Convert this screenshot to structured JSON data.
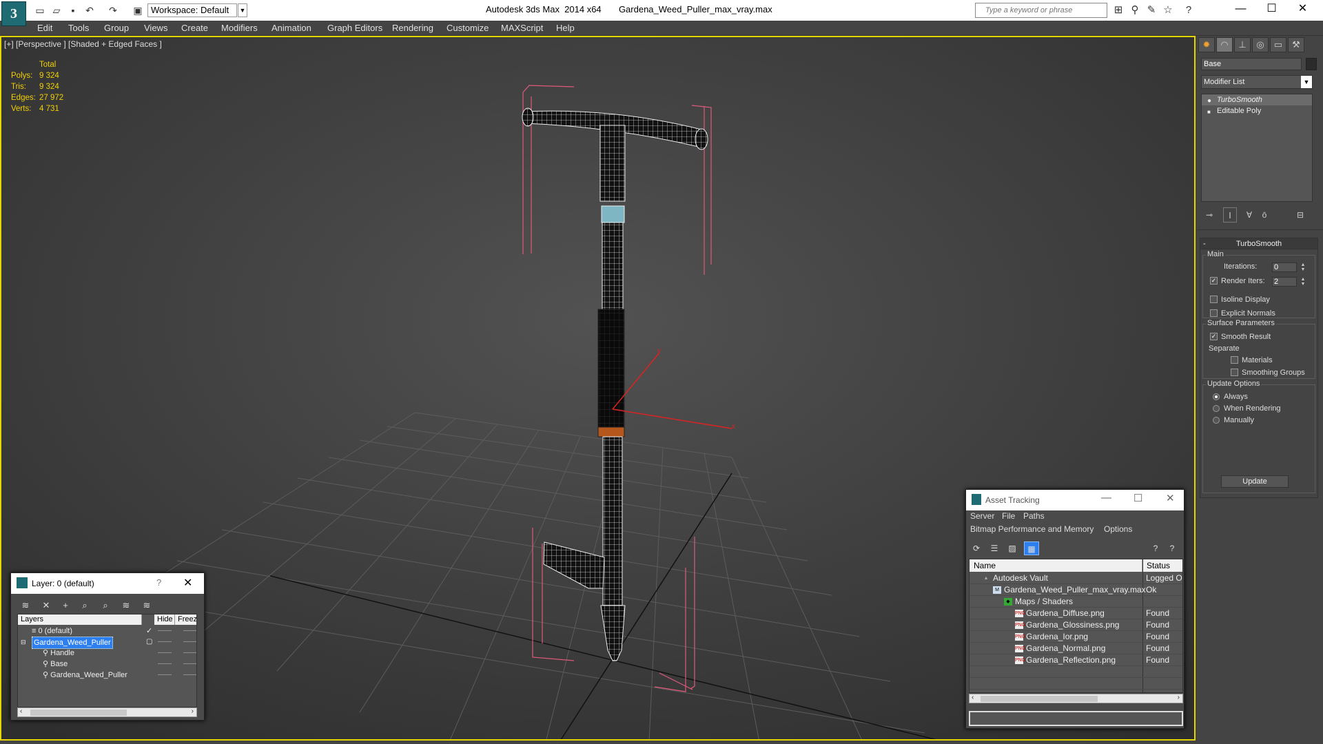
{
  "app": {
    "logo_letter": "3",
    "workspace": "Workspace: Default",
    "title": "Autodesk 3ds Max  2014 x64       Gardena_Weed_Puller_max_vray.max",
    "search_placeholder": "Type a keyword or phrase"
  },
  "menu": [
    "Edit",
    "Tools",
    "Group",
    "Views",
    "Create",
    "Modifiers",
    "Animation",
    "Graph Editors",
    "Rendering",
    "Customize",
    "MAXScript",
    "Help"
  ],
  "viewport": {
    "label": "[+] [Perspective ] [Shaded + Edged Faces ]",
    "stats_header": "Total",
    "stats": [
      {
        "k": "Polys:",
        "v": "9 324"
      },
      {
        "k": "Tris:",
        "v": "9 324"
      },
      {
        "k": "Edges:",
        "v": "27 972"
      },
      {
        "k": "Verts:",
        "v": "4 731"
      }
    ],
    "axis": {
      "x": "x",
      "y": "y"
    }
  },
  "command_panel": {
    "object_name": "Base",
    "modifier_list": "Modifier List",
    "stack": [
      "TurboSmooth",
      "Editable Poly"
    ],
    "rollout_title": "TurboSmooth",
    "main_label": "Main",
    "iterations_label": "Iterations:",
    "iterations_value": "0",
    "render_iters_label": "Render Iters:",
    "render_iters_value": "2",
    "isoline": "Isoline Display",
    "explicit": "Explicit Normals",
    "surface_label": "Surface Parameters",
    "smooth_result": "Smooth Result",
    "separate_label": "Separate",
    "materials": "Materials",
    "smoothing_groups": "Smoothing Groups",
    "update_label": "Update Options",
    "always": "Always",
    "when_rendering": "When Rendering",
    "manually": "Manually",
    "update_button": "Update"
  },
  "layer_dialog": {
    "title": "Layer: 0 (default)",
    "help": "?",
    "col_layers": "Layers",
    "col_hide": "Hide",
    "col_freeze": "Freez",
    "rows": [
      "0 (default)",
      "Gardena_Weed_Puller",
      "Handle",
      "Base",
      "Gardena_Weed_Puller"
    ]
  },
  "asset_tracking": {
    "title": "Asset Tracking",
    "menu_server": "Server",
    "menu_file": "File",
    "menu_paths": "Paths",
    "menu_bitmap": "Bitmap Performance and Memory",
    "menu_options": "Options",
    "col_name": "Name",
    "col_status": "Status",
    "rows": [
      {
        "name": "Autodesk Vault",
        "status": "Logged O"
      },
      {
        "name": "Gardena_Weed_Puller_max_vray.max",
        "status": "Ok"
      },
      {
        "name": "Maps / Shaders",
        "status": ""
      },
      {
        "name": "Gardena_Diffuse.png",
        "status": "Found"
      },
      {
        "name": "Gardena_Glossiness.png",
        "status": "Found"
      },
      {
        "name": "Gardena_Ior.png",
        "status": "Found"
      },
      {
        "name": "Gardena_Normal.png",
        "status": "Found"
      },
      {
        "name": "Gardena_Reflection.png",
        "status": "Found"
      }
    ],
    "png_badge": "PNG"
  }
}
